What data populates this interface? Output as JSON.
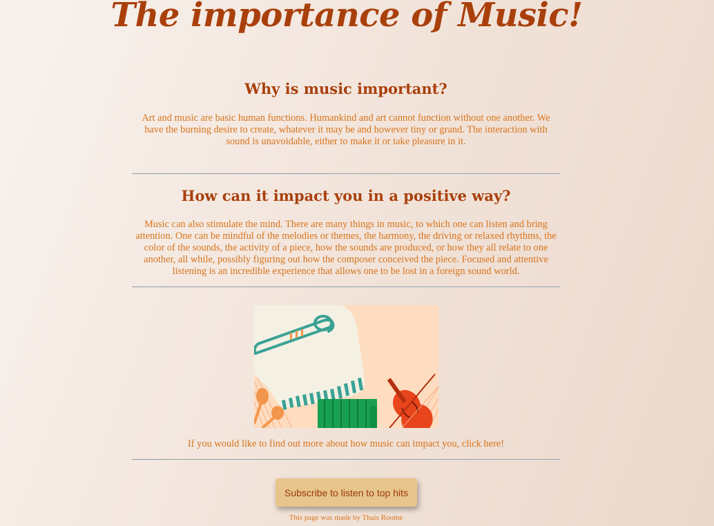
{
  "page": {
    "title": "The importance of Music!"
  },
  "section1": {
    "heading": "Why is music important?",
    "text": "Art and music are basic human functions. Humankind and art cannot function without one another. We have the burning desire to create, whatever it may be and however tiny or grand. The interaction with sound is unavoidable, either to make it or take pleasure in it."
  },
  "section2": {
    "heading": "How can it impact you in a positive way?",
    "text": "Music can also stimulate the mind. There are many things in music, to which one can listen and bring attention. One can be mindful of the melodies or themes, the harmony, the driving or relaxed rhythms, the color of the sounds, the activity of a piece, how the sounds are produced, or how they all relate to one another, all while, possibly figuring out how the composer conceived the piece. Focused and attentive listening is an incredible experience that allows one to be lost in a foreign sound world."
  },
  "illustration": {
    "icon": "musical-instruments-illustration"
  },
  "cta": {
    "link_text": "If you would like to find out more about how music can impact you, click here!"
  },
  "subscribe": {
    "label": "Subscribe to listen to top hits"
  },
  "footer": {
    "text": "This page was made by Thais Roome"
  },
  "colors": {
    "heading": "#a9400c",
    "body_text": "#d8741c",
    "button_bg": "#e7c58d"
  }
}
